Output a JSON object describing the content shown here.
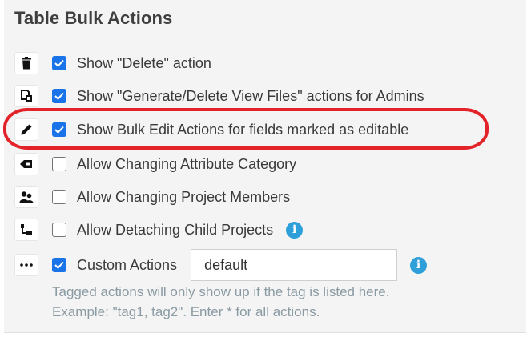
{
  "section": {
    "title": "Table Bulk Actions"
  },
  "options": [
    {
      "icon": "trash-icon",
      "label": "Show \"Delete\" action",
      "checked": true
    },
    {
      "icon": "file-copy-icon",
      "label": "Show \"Generate/Delete View Files\" actions for Admins",
      "checked": true
    },
    {
      "icon": "pencil-icon",
      "label": "Show Bulk Edit Actions for fields marked as editable",
      "checked": true
    },
    {
      "icon": "tag-icon",
      "label": "Allow Changing Attribute Category",
      "checked": false
    },
    {
      "icon": "users-icon",
      "label": "Allow Changing Project Members",
      "checked": false
    },
    {
      "icon": "hierarchy-icon",
      "label": "Allow Detaching Child Projects",
      "checked": false
    },
    {
      "icon": "ellipsis-icon",
      "label": "Custom Actions",
      "checked": true
    }
  ],
  "custom_actions": {
    "value": "default",
    "help_line1": "Tagged actions will only show up if the tag is listed here.",
    "help_line2": "Example: \"tag1, tag2\". Enter * for all actions."
  },
  "info_icon_glyph": "i",
  "colors": {
    "checkbox": "#1a73e8",
    "info": "#2e9fd8",
    "highlight": "#e3232a"
  }
}
